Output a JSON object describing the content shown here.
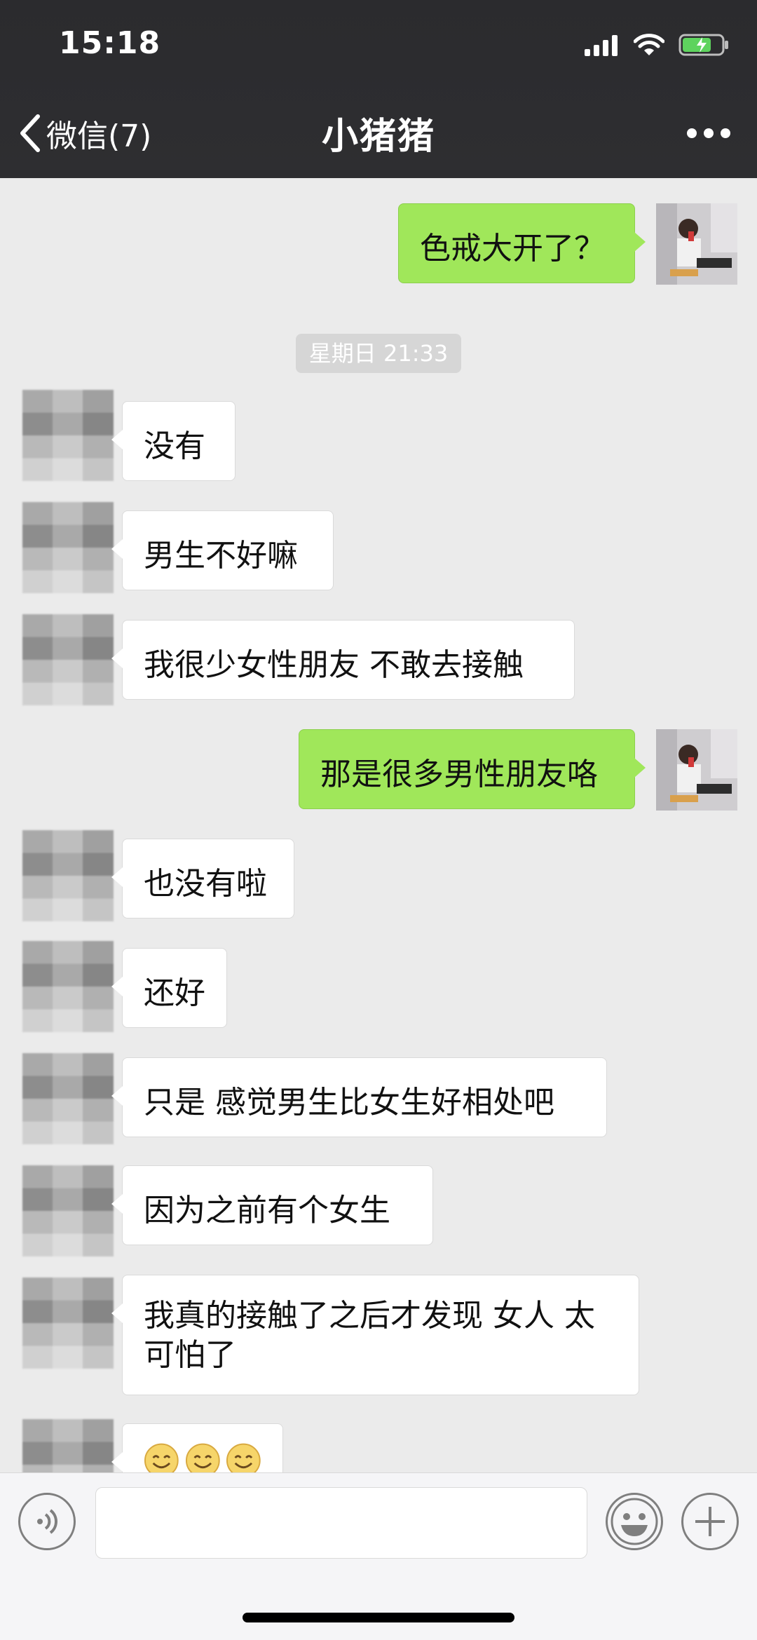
{
  "status_bar": {
    "time": "15:18"
  },
  "nav": {
    "back_label": "微信(7)",
    "title": "小猪猪"
  },
  "timestamp": "星期日 21:33",
  "messages": [
    {
      "side": "right",
      "text": "色戒大开了？"
    },
    {
      "side": "left",
      "text": "没有"
    },
    {
      "side": "left",
      "text": "男生不好嘛"
    },
    {
      "side": "left",
      "text": "我很少女性朋友 不敢去接触"
    },
    {
      "side": "right",
      "text": "那是很多男性朋友咯"
    },
    {
      "side": "left",
      "text": "也没有啦"
    },
    {
      "side": "left",
      "text": "还好"
    },
    {
      "side": "left",
      "text": "只是 感觉男生比女生好相处吧"
    },
    {
      "side": "left",
      "text": "因为之前有个女生"
    },
    {
      "side": "left",
      "text": "我真的接触了之后才发现 女人 太可怕了"
    },
    {
      "side": "left",
      "emoji": [
        "smile-emoji",
        "smile-emoji",
        "smile-emoji"
      ]
    }
  ],
  "colors": {
    "header_bg": "#2e2e31",
    "chat_bg": "#ebebeb",
    "bubble_sent": "#a0e75a",
    "bubble_received": "#ffffff"
  }
}
